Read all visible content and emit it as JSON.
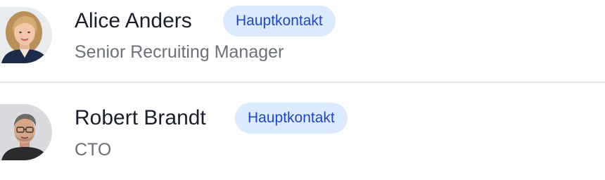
{
  "contacts": [
    {
      "name": "Alice Anders",
      "badge": "Hauptkontakt",
      "role": "Senior Recruiting Manager",
      "avatar": "avatar-photo-woman"
    },
    {
      "name": "Robert Brandt",
      "badge": "Hauptkontakt",
      "role": "CTO",
      "avatar": "avatar-photo-man"
    }
  ],
  "colors": {
    "name_text": "#1a1f2b",
    "role_text": "#6b7079",
    "badge_bg": "#dbeafe",
    "badge_text": "#1f47c2",
    "divider": "#e6e7ea"
  }
}
